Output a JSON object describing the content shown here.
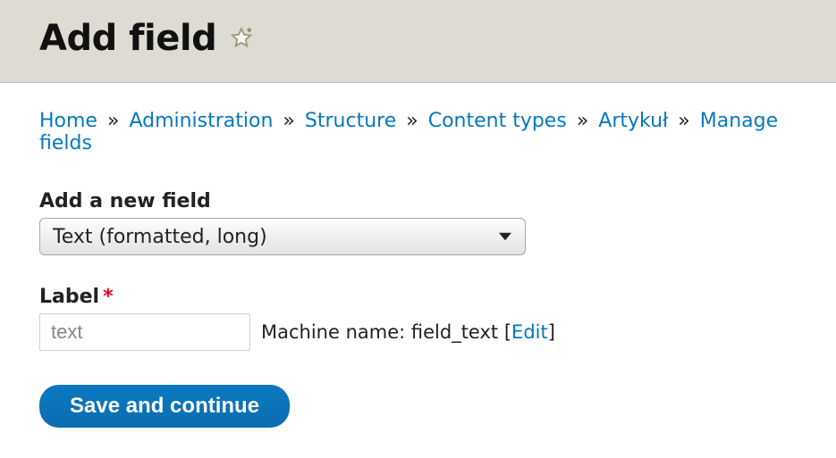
{
  "header": {
    "title": "Add field"
  },
  "breadcrumb": {
    "items": [
      {
        "label": "Home"
      },
      {
        "label": "Administration"
      },
      {
        "label": "Structure"
      },
      {
        "label": "Content types"
      },
      {
        "label": "Artykuł"
      },
      {
        "label": "Manage fields"
      }
    ],
    "separator": "»"
  },
  "form": {
    "field_type_label": "Add a new field",
    "field_type_value": "Text (formatted, long)",
    "label_label": "Label",
    "label_value": "text",
    "machine_name_prefix": "Machine name: ",
    "machine_name_value": "field_text",
    "machine_name_edit": "Edit",
    "submit_label": "Save and continue"
  }
}
